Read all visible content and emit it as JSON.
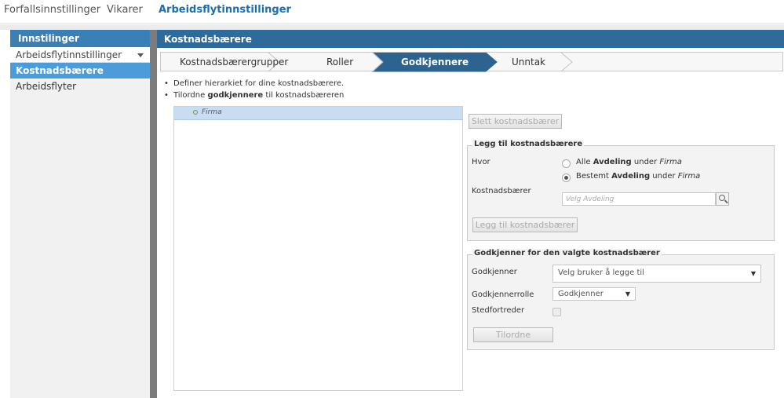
{
  "topnav": {
    "tabs": [
      {
        "label": "Forfallsinnstillinger"
      },
      {
        "label": "Vikarer"
      },
      {
        "label": "Arbeidsflytinnstillinger"
      }
    ]
  },
  "sidebar": {
    "header": "Innstilinger",
    "select_value": "Arbeidsflytinnstillinger",
    "items": [
      {
        "label": "Kostnadsbærere"
      },
      {
        "label": "Arbeidsflyter"
      }
    ]
  },
  "main": {
    "header": "Kostnadsbærere",
    "steps": [
      {
        "label": "Kostnadsbærergrupper"
      },
      {
        "label": "Roller"
      },
      {
        "label": "Godkjennere"
      },
      {
        "label": "Unntak"
      }
    ],
    "instructions": {
      "line1": "Definer hierarkiet for dine kostnadsbærere.",
      "line2_pre": "Tilordne ",
      "line2_bold": "godkjennere",
      "line2_post": " til kostnadsbæreren"
    },
    "tree": {
      "root": "Firma"
    },
    "delete_button": "Slett kostnadsbærer",
    "add_section": {
      "legend": "Legg til kostnadsbærere",
      "where_label": "Hvor",
      "option1_pre": "Alle ",
      "option1_bold": "Avdeling",
      "option1_mid": " under ",
      "option1_italic": "Firma",
      "option2_pre": "Bestemt ",
      "option2_bold": "Avdeling",
      "option2_mid": " under ",
      "option2_italic": "Firma",
      "field_label": "Kostnadsbærer",
      "search_placeholder": "Velg Avdeling",
      "add_button": "Legg til kostnadsbærer"
    },
    "approver_section": {
      "legend": "Godkjenner for den valgte kostnadsbærer",
      "approver_label": "Godkjenner",
      "approver_placeholder": "Velg bruker å legge til",
      "role_label": "Godkjennerrolle",
      "role_value": "Godkjenner",
      "deputy_label": "Stedfortreder",
      "assign_button": "Tilordne"
    }
  }
}
